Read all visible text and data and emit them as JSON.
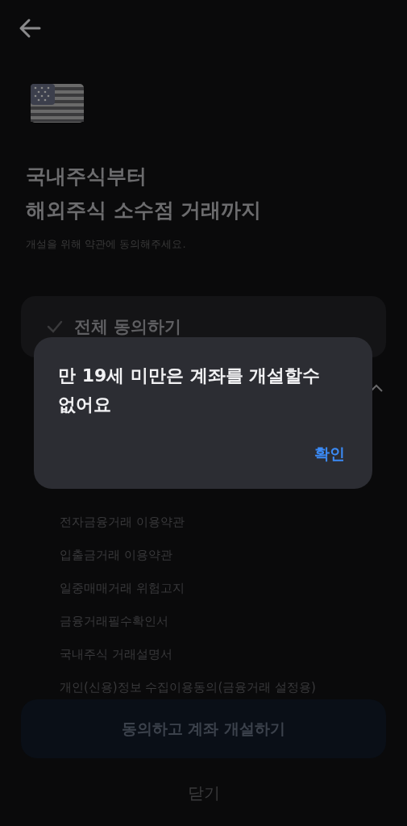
{
  "header": {
    "title_lines": [
      "국내주식부터",
      "해외주식 소수점 거래까지"
    ],
    "subtitle": "개설을 위해 약관에 동의해주세요."
  },
  "agree_all": {
    "label": "전체 동의하기",
    "checked": false
  },
  "terms_section": {
    "expanded": true
  },
  "terms": [
    {
      "label": "전자금융거래 이용약관"
    },
    {
      "label": "입출금거래 이용약관"
    },
    {
      "label": "일중매매거래 위험고지"
    },
    {
      "label": "금융거래필수확인서"
    },
    {
      "label": "국내주식 거래설명서"
    },
    {
      "label": "개인(신용)정보 수집이용동의(금융거래 설정용)"
    }
  ],
  "primary_button": {
    "label": "동의하고 계좌 개설하기",
    "disabled": true
  },
  "close_button": {
    "label": "닫기"
  },
  "dialog": {
    "message": "만 19세 미만은 계좌를 개설할수 없어요",
    "confirm": "확인"
  }
}
